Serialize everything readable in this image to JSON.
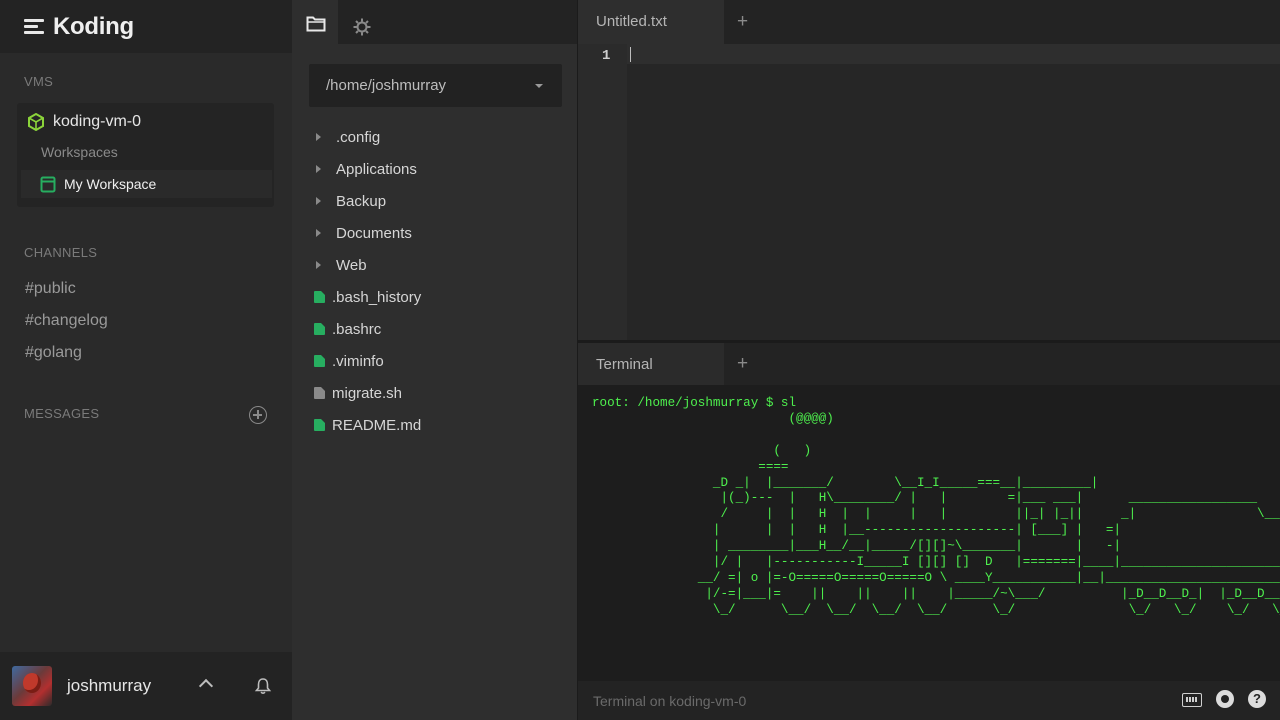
{
  "app": {
    "title": "Koding"
  },
  "sidebar": {
    "vms_label": "VMS",
    "vm": {
      "name": "koding-vm-0",
      "workspaces_label": "Workspaces",
      "workspace": "My Workspace"
    },
    "channels_label": "CHANNELS",
    "channels": [
      "#public",
      "#changelog",
      "#golang"
    ],
    "messages_label": "MESSAGES",
    "user": {
      "name": "joshmurray"
    }
  },
  "file_tree": {
    "path": "/home/joshmurray",
    "folders": [
      ".config",
      "Applications",
      "Backup",
      "Documents",
      "Web"
    ],
    "files": [
      {
        "name": ".bash_history",
        "color": "#27ae60"
      },
      {
        "name": ".bashrc",
        "color": "#27ae60"
      },
      {
        "name": ".viminfo",
        "color": "#27ae60"
      },
      {
        "name": "migrate.sh",
        "color": "#8a8a8a"
      },
      {
        "name": "README.md",
        "color": "#27ae60"
      }
    ]
  },
  "editor": {
    "tab": "Untitled.txt",
    "line_number": "1",
    "add_tab": "+"
  },
  "terminal": {
    "tab": "Terminal",
    "add_tab": "+",
    "prompt": "root: /home/joshmurray $ sl",
    "output": "                          (@@@@)\n\n                        (   )\n                      ====\n                _D _|  |_______/        \\__I_I_____===__|_________|\n                 |(_)---  |   H\\________/ |   |        =|___ ___|      _________________\n                 /     |  |   H  |  |     |   |         ||_| |_||     _|                \\_____A\n                |      |  |   H  |__--------------------| [___] |   =|                        |\n                | ________|___H__/__|_____/[][]~\\_______|       |   -|                        |\n                |/ |   |-----------I_____I [][] []  D   |=======|____|________________________|_\n              __/ =| o |=-O=====O=====O=====O \\ ____Y___________|__|__________________________|_\n               |/-=|___|=    ||    ||    ||    |_____/~\\___/          |_D__D__D_|  |_D__D__D_|\n                \\_/      \\__/  \\__/  \\__/  \\__/      \\_/               \\_/   \\_/    \\_/   \\_/",
    "status": "Terminal on koding-vm-0"
  },
  "colors": {
    "accent": "#27ae60",
    "terminal_text": "#4ef04e"
  }
}
